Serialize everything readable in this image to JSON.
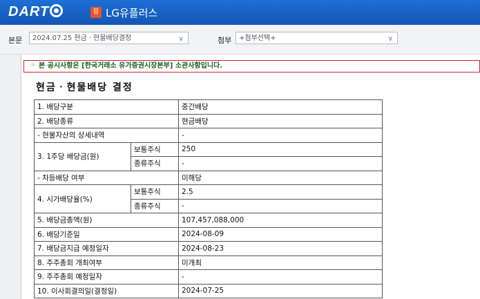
{
  "app": {
    "logo_text": "DART",
    "corp_badge": "유",
    "corp_name": "LG유플러스"
  },
  "toolbar": {
    "doc_label": "본문",
    "doc_select_value": "2024.07.25  현금ㆍ현물배당결정",
    "attach_label": "첨부",
    "attach_select_value": "+첨부선택+"
  },
  "notice": {
    "icon": "pointing-hand-icon",
    "text": "본 공시사항은 [한국거래소 유가증권시장본부] 소관사항입니다."
  },
  "document": {
    "title": "현금ㆍ현물배당 결정",
    "rows": [
      {
        "label": "1. 배당구분",
        "value": "중간배당"
      },
      {
        "label": "2. 배당종류",
        "value": "현금배당"
      },
      {
        "label": "- 현물자산의 상세내역",
        "value": "-"
      },
      {
        "label": "3. 1주당 배당금(원)",
        "sub": "보통주식",
        "value": "250"
      },
      {
        "sub": "종류주식",
        "value": "-"
      },
      {
        "label": "- 차등배당 여부",
        "value": "미해당"
      },
      {
        "label": "4. 시가배당율(%)",
        "sub": "보통주식",
        "value": "2.5"
      },
      {
        "sub": "종류주식",
        "value": "-"
      },
      {
        "label": "5. 배당금총액(원)",
        "value": "107,457,088,000"
      },
      {
        "label": "6. 배당기준일",
        "value": "2024-08-09"
      },
      {
        "label": "7. 배당금지급 예정일자",
        "value": "2024-08-23"
      },
      {
        "label": "8. 주주총회 개최여부",
        "value": "미개최"
      },
      {
        "label": "9. 주주총회 예정일자",
        "value": "-"
      },
      {
        "label": "10. 이사회결의일(결정일)",
        "value": "2024-07-25"
      }
    ]
  }
}
